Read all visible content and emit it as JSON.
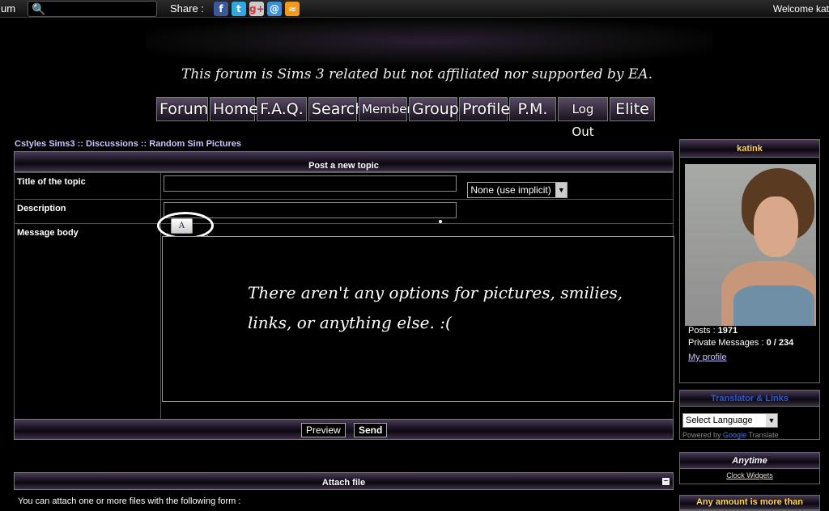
{
  "topbar": {
    "left_label": "um",
    "share_label": "Share :",
    "share_icons": [
      "facebook-icon",
      "twitter-icon",
      "google-plus-icon",
      "email-icon",
      "rss-icon"
    ],
    "welcome": "Welcome kat"
  },
  "disclaimer": "This forum is Sims 3 related but not affiliated nor supported by EA.",
  "nav": [
    "Forum",
    "Home",
    "F.A.Q.",
    "Search",
    "Members",
    "Groups",
    "Profile",
    "P.M.",
    "Log Out",
    "Elite"
  ],
  "breadcrumb": "Cstyles Sims3  :: Discussions :: Random Sim Pictures",
  "form": {
    "header": "Post a new topic",
    "title_label": "Title of the topic",
    "title_value": "",
    "icon_select": "None (use implicit)",
    "description_label": "Description",
    "description_value": "",
    "message_label": "Message body",
    "font_button": "A",
    "message_value": ""
  },
  "annotation": {
    "line1": "There aren't any options for pictures, smilies,",
    "line2": "links, or anything else.  :("
  },
  "buttons": {
    "preview": "Preview",
    "send": "Send"
  },
  "attach": {
    "header": "Attach file",
    "text": "You can attach one or more files with the following form :"
  },
  "sidebar": {
    "user_box": {
      "username": "katink",
      "posts_label": "Posts :",
      "posts_value": "1971",
      "pm_label": "Private Messages :",
      "pm_value": "0 / 234",
      "profile_link": "My profile"
    },
    "translate": {
      "header": "Translator & Links",
      "select_value": "Select Language",
      "powered_by": "Powered by",
      "google": "Google",
      "translate": "Translate"
    },
    "anytime": {
      "header": "Anytime",
      "link": "Clock Widgets"
    },
    "any_amount": {
      "header": "Any amount is more than"
    }
  },
  "colors": {
    "accent_purple": "#4a3a58",
    "link": "#c9c4ff",
    "warning_yellow": "#ffd54a"
  }
}
